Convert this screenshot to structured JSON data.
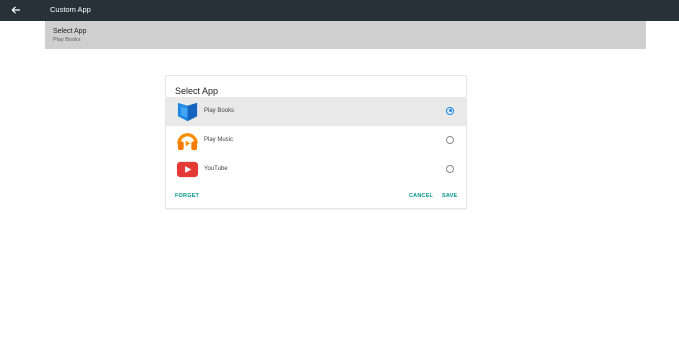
{
  "topbar": {
    "title": "Custom App",
    "back_icon": "arrow-left-icon"
  },
  "setting": {
    "title": "Select App",
    "value": "Play Books"
  },
  "dialog": {
    "title": "Select App",
    "options": [
      {
        "label": "Play Books",
        "icon": "play-books-icon",
        "selected": true
      },
      {
        "label": "Play Music",
        "icon": "play-music-icon",
        "selected": false
      },
      {
        "label": "YouTube",
        "icon": "youtube-icon",
        "selected": false
      }
    ],
    "actions": {
      "forget": "FORGET",
      "cancel": "CANCEL",
      "save": "SAVE"
    }
  },
  "colors": {
    "topbar": "#263238",
    "accent": "#009688",
    "radio": "#1e88e5",
    "row_bg": "#cfcfcf"
  }
}
